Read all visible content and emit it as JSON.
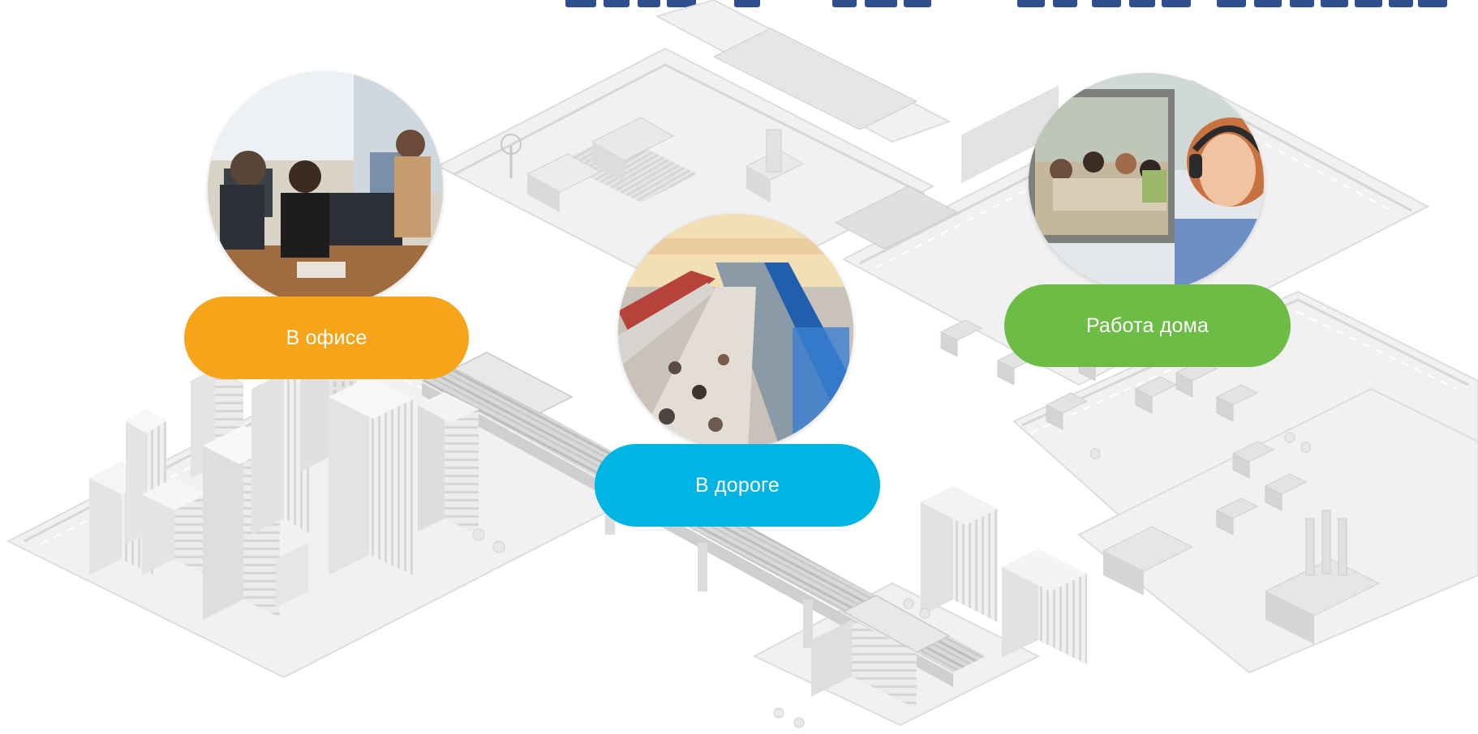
{
  "locations": [
    {
      "key": "office",
      "label": "В офисе",
      "color": "#f6a51b"
    },
    {
      "key": "road",
      "label": "В дороге",
      "color": "#00b4e4"
    },
    {
      "key": "home",
      "label": "Работа дома",
      "color": "#6cbc46"
    }
  ],
  "theme": {
    "heading_color": "#2d4f8e",
    "city_base": "#efefef",
    "city_building": "#e2e2e2",
    "city_shadow": "#d3d3d3"
  }
}
